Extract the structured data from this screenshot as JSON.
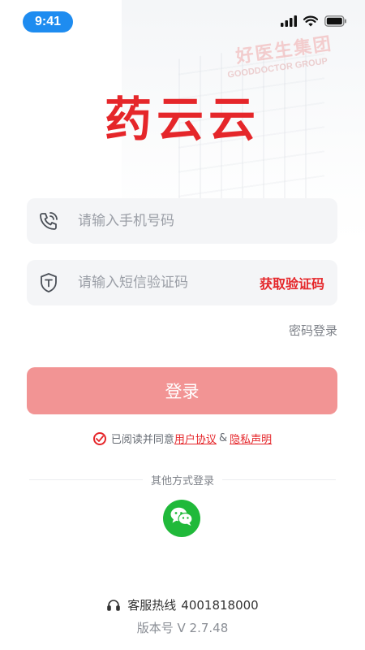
{
  "status_bar": {
    "time": "9:41"
  },
  "background": {
    "sign_cn": "好医生集团",
    "sign_en": "GOODDOCTOR GROUP"
  },
  "logo": {
    "text": "药云云"
  },
  "phone_field": {
    "placeholder": "请输入手机号码",
    "value": ""
  },
  "code_field": {
    "placeholder": "请输入短信验证码",
    "value": "",
    "get_code_label": "获取验证码"
  },
  "password_login_label": "密码登录",
  "login_button_label": "登录",
  "agreement": {
    "prefix": "已阅读并同意",
    "user_agreement": "用户协议",
    "amp": "&",
    "privacy": "隐私声明"
  },
  "other_login": {
    "label": "其他方式登录"
  },
  "footer": {
    "hotline_label": "客服热线",
    "hotline_number": "4001818000",
    "version": "版本号 V 2.7.48"
  },
  "colors": {
    "brand": "#e5262a",
    "login_button": "#f29494",
    "wechat": "#20b93a",
    "time_pill": "#1e8cf0"
  },
  "icons": {
    "phone": "phone-call-icon",
    "shield": "shield-t-icon",
    "check": "check-circle-icon",
    "wechat": "wechat-icon",
    "headset": "headset-icon"
  }
}
